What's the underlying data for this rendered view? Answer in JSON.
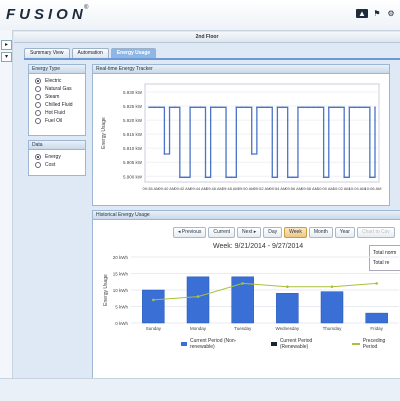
{
  "app": {
    "brand": "FUSION",
    "brand_mark": "®",
    "icons": [
      "bell-icon",
      "cart-icon",
      "settings-icon"
    ]
  },
  "panel": {
    "title": "2nd Floor"
  },
  "tabs": [
    {
      "label": "Summary View",
      "active": false
    },
    {
      "label": "Automation",
      "active": false
    },
    {
      "label": "Energy Usage",
      "active": true
    }
  ],
  "energy_type": {
    "title": "Energy Type",
    "options": [
      {
        "label": "Electric",
        "selected": true
      },
      {
        "label": "Natural Gas",
        "selected": false
      },
      {
        "label": "Steam",
        "selected": false
      },
      {
        "label": "Chilled Fluid",
        "selected": false
      },
      {
        "label": "Hot Fluid",
        "selected": false
      },
      {
        "label": "Fuel Oil",
        "selected": false
      }
    ]
  },
  "data_box": {
    "title": "Data",
    "options": [
      {
        "label": "Energy",
        "selected": true
      },
      {
        "label": "Cost",
        "selected": false
      }
    ]
  },
  "realtime": {
    "title": "Real-time Energy Tracker"
  },
  "historical": {
    "title": "Historical Energy Usage",
    "nav": {
      "previous": "Previous",
      "current": "Current",
      "next": "Next",
      "day": "Day",
      "week": "Week",
      "month": "Month",
      "year": "Year",
      "disabled": "Chart to Csv"
    },
    "chart_title": "Week: 9/21/2014 - 9/27/2014",
    "totals": [
      "Total norm",
      "Total re"
    ]
  },
  "colors": {
    "accent": "#6c9ad6",
    "line": "#4a73c9",
    "bar": "#3a6fd6",
    "bar_renew": "#1c2430",
    "preceding": "#a8c23a"
  },
  "chart_data": [
    {
      "type": "line",
      "title": "Real-time Energy Tracker",
      "ylabel": "Energy Usage",
      "xlabel": "",
      "ylim": [
        5.909,
        5.93
      ],
      "y_ticks": [
        "5.930 kW",
        "5.925 kW",
        "5.920 kW",
        "5.915 kW",
        "5.910 kW",
        "5.905 kW",
        "5.900 kW"
      ],
      "x_ticks": [
        "09:38 AM",
        "09:40 AM",
        "09:42 AM",
        "09:44 AM",
        "09:46 AM",
        "09:48 AM",
        "09:50 AM",
        "09:52 AM",
        "09:54 AM",
        "09:56 AM",
        "09:58 AM",
        "10:00 AM",
        "10:02 AM",
        "10:04 AM",
        "10:06 AM"
      ],
      "values": [
        5.925,
        5.925,
        5.925,
        5.915,
        5.925,
        5.925,
        5.91,
        5.91,
        5.925,
        5.925,
        5.925,
        5.91,
        5.925,
        5.925,
        5.925,
        5.91,
        5.91,
        5.925,
        5.925,
        5.925,
        5.915,
        5.925,
        5.925,
        5.925,
        5.91,
        5.925,
        5.925,
        5.91,
        5.91,
        5.925,
        5.925,
        5.925,
        5.925,
        5.925,
        5.91,
        5.925,
        5.925,
        5.925,
        5.91,
        5.925,
        5.925,
        5.925,
        5.925,
        5.91,
        5.925
      ]
    },
    {
      "type": "bar",
      "title": "Week: 9/21/2014 - 9/27/2014",
      "ylabel": "Energy Usage",
      "xlabel": "",
      "ylim": [
        0,
        20
      ],
      "y_ticks": [
        "20 kWh",
        "15 kWh",
        "10 kWh",
        "5 kWh",
        "0 kWh"
      ],
      "categories": [
        "Sunday",
        "Monday",
        "Tuesday",
        "Wednesday",
        "Thursday",
        "Friday"
      ],
      "series": [
        {
          "name": "Current Period (Non-renewable)",
          "values": [
            10,
            14,
            14,
            9,
            9.5,
            3
          ]
        },
        {
          "name": "Current Period (Renewable)",
          "values": [
            0,
            0,
            0,
            0,
            0,
            0
          ]
        },
        {
          "name": "Preceding Period",
          "values": [
            7,
            8,
            12,
            11,
            11,
            12
          ]
        }
      ]
    }
  ]
}
